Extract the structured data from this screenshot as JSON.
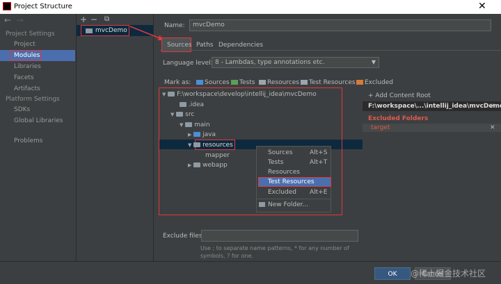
{
  "window": {
    "title": "Project Structure",
    "close_glyph": "✕"
  },
  "nav": {
    "back": "←",
    "forward": "→"
  },
  "sidebar": {
    "project_settings_header": "Project Settings",
    "project_items": [
      "Project",
      "Modules",
      "Libraries",
      "Facets",
      "Artifacts"
    ],
    "platform_settings_header": "Platform Settings",
    "platform_items": [
      "SDKs",
      "Global Libraries"
    ],
    "problems": "Problems"
  },
  "module_toolbar": {
    "add": "+",
    "remove": "−",
    "copy": "⧉"
  },
  "modules": [
    "mvcDemo"
  ],
  "name_label": "Name:",
  "name_value": "mvcDemo",
  "tabs": [
    "Sources",
    "Paths",
    "Dependencies"
  ],
  "language_level_label": "Language level:",
  "language_level_value": "8 - Lambdas, type annotations etc.",
  "mark_as_label": "Mark as:",
  "mark_as": [
    {
      "label": "Sources",
      "color": "#4c8fd6"
    },
    {
      "label": "Tests",
      "color": "#5aa05a"
    },
    {
      "label": "Resources",
      "color": "#9aa5ad"
    },
    {
      "label": "Test Resources",
      "color": "#9aa5ad"
    },
    {
      "label": "Excluded",
      "color": "#d97a3a"
    }
  ],
  "tree": {
    "root": "F:\\workspace\\develop\\intellij_idea\\mvcDemo",
    "idea": ".idea",
    "src": "src",
    "main": "main",
    "java": "java",
    "resources": "resources",
    "mapper": "mapper",
    "webapp": "webapp"
  },
  "context_menu": [
    {
      "label": "Sources",
      "shortcut": "Alt+S"
    },
    {
      "label": "Tests",
      "shortcut": "Alt+T"
    },
    {
      "label": "Resources",
      "shortcut": ""
    },
    {
      "label": "Test Resources",
      "shortcut": ""
    },
    {
      "label": "Excluded",
      "shortcut": "Alt+E"
    },
    {
      "label": "New Folder...",
      "shortcut": ""
    }
  ],
  "content_root": {
    "add_label": "+ Add Content Root",
    "path": "F:\\workspace\\...\\intellij_idea\\mvcDemo",
    "excluded_header": "Excluded Folders",
    "excluded_item": "target",
    "remove_glyph": "✕"
  },
  "exclude_files_label": "Exclude files:",
  "exclude_hint": "Use ; to separate name patterns, * for any number of symbols, ? for one.",
  "buttons": {
    "ok": "OK",
    "cancel": "Cancel"
  },
  "watermark": "@稀土掘金技术社区",
  "colors": {
    "selection": "#4b6eaf",
    "highlight": "#e0393e",
    "excluded": "#e05a4e"
  }
}
